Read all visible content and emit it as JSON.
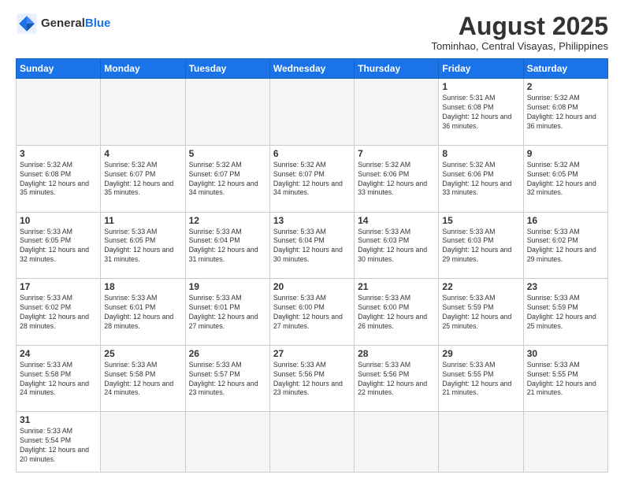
{
  "header": {
    "logo_general": "General",
    "logo_blue": "Blue",
    "month_year": "August 2025",
    "location": "Tominhao, Central Visayas, Philippines"
  },
  "weekdays": [
    "Sunday",
    "Monday",
    "Tuesday",
    "Wednesday",
    "Thursday",
    "Friday",
    "Saturday"
  ],
  "weeks": [
    [
      {
        "day": "",
        "info": ""
      },
      {
        "day": "",
        "info": ""
      },
      {
        "day": "",
        "info": ""
      },
      {
        "day": "",
        "info": ""
      },
      {
        "day": "",
        "info": ""
      },
      {
        "day": "1",
        "info": "Sunrise: 5:31 AM\nSunset: 6:08 PM\nDaylight: 12 hours and 36 minutes."
      },
      {
        "day": "2",
        "info": "Sunrise: 5:32 AM\nSunset: 6:08 PM\nDaylight: 12 hours and 36 minutes."
      }
    ],
    [
      {
        "day": "3",
        "info": "Sunrise: 5:32 AM\nSunset: 6:08 PM\nDaylight: 12 hours and 35 minutes."
      },
      {
        "day": "4",
        "info": "Sunrise: 5:32 AM\nSunset: 6:07 PM\nDaylight: 12 hours and 35 minutes."
      },
      {
        "day": "5",
        "info": "Sunrise: 5:32 AM\nSunset: 6:07 PM\nDaylight: 12 hours and 34 minutes."
      },
      {
        "day": "6",
        "info": "Sunrise: 5:32 AM\nSunset: 6:07 PM\nDaylight: 12 hours and 34 minutes."
      },
      {
        "day": "7",
        "info": "Sunrise: 5:32 AM\nSunset: 6:06 PM\nDaylight: 12 hours and 33 minutes."
      },
      {
        "day": "8",
        "info": "Sunrise: 5:32 AM\nSunset: 6:06 PM\nDaylight: 12 hours and 33 minutes."
      },
      {
        "day": "9",
        "info": "Sunrise: 5:32 AM\nSunset: 6:05 PM\nDaylight: 12 hours and 32 minutes."
      }
    ],
    [
      {
        "day": "10",
        "info": "Sunrise: 5:33 AM\nSunset: 6:05 PM\nDaylight: 12 hours and 32 minutes."
      },
      {
        "day": "11",
        "info": "Sunrise: 5:33 AM\nSunset: 6:05 PM\nDaylight: 12 hours and 31 minutes."
      },
      {
        "day": "12",
        "info": "Sunrise: 5:33 AM\nSunset: 6:04 PM\nDaylight: 12 hours and 31 minutes."
      },
      {
        "day": "13",
        "info": "Sunrise: 5:33 AM\nSunset: 6:04 PM\nDaylight: 12 hours and 30 minutes."
      },
      {
        "day": "14",
        "info": "Sunrise: 5:33 AM\nSunset: 6:03 PM\nDaylight: 12 hours and 30 minutes."
      },
      {
        "day": "15",
        "info": "Sunrise: 5:33 AM\nSunset: 6:03 PM\nDaylight: 12 hours and 29 minutes."
      },
      {
        "day": "16",
        "info": "Sunrise: 5:33 AM\nSunset: 6:02 PM\nDaylight: 12 hours and 29 minutes."
      }
    ],
    [
      {
        "day": "17",
        "info": "Sunrise: 5:33 AM\nSunset: 6:02 PM\nDaylight: 12 hours and 28 minutes."
      },
      {
        "day": "18",
        "info": "Sunrise: 5:33 AM\nSunset: 6:01 PM\nDaylight: 12 hours and 28 minutes."
      },
      {
        "day": "19",
        "info": "Sunrise: 5:33 AM\nSunset: 6:01 PM\nDaylight: 12 hours and 27 minutes."
      },
      {
        "day": "20",
        "info": "Sunrise: 5:33 AM\nSunset: 6:00 PM\nDaylight: 12 hours and 27 minutes."
      },
      {
        "day": "21",
        "info": "Sunrise: 5:33 AM\nSunset: 6:00 PM\nDaylight: 12 hours and 26 minutes."
      },
      {
        "day": "22",
        "info": "Sunrise: 5:33 AM\nSunset: 5:59 PM\nDaylight: 12 hours and 25 minutes."
      },
      {
        "day": "23",
        "info": "Sunrise: 5:33 AM\nSunset: 5:59 PM\nDaylight: 12 hours and 25 minutes."
      }
    ],
    [
      {
        "day": "24",
        "info": "Sunrise: 5:33 AM\nSunset: 5:58 PM\nDaylight: 12 hours and 24 minutes."
      },
      {
        "day": "25",
        "info": "Sunrise: 5:33 AM\nSunset: 5:58 PM\nDaylight: 12 hours and 24 minutes."
      },
      {
        "day": "26",
        "info": "Sunrise: 5:33 AM\nSunset: 5:57 PM\nDaylight: 12 hours and 23 minutes."
      },
      {
        "day": "27",
        "info": "Sunrise: 5:33 AM\nSunset: 5:56 PM\nDaylight: 12 hours and 23 minutes."
      },
      {
        "day": "28",
        "info": "Sunrise: 5:33 AM\nSunset: 5:56 PM\nDaylight: 12 hours and 22 minutes."
      },
      {
        "day": "29",
        "info": "Sunrise: 5:33 AM\nSunset: 5:55 PM\nDaylight: 12 hours and 21 minutes."
      },
      {
        "day": "30",
        "info": "Sunrise: 5:33 AM\nSunset: 5:55 PM\nDaylight: 12 hours and 21 minutes."
      }
    ],
    [
      {
        "day": "31",
        "info": "Sunrise: 5:33 AM\nSunset: 5:54 PM\nDaylight: 12 hours and 20 minutes."
      },
      {
        "day": "",
        "info": ""
      },
      {
        "day": "",
        "info": ""
      },
      {
        "day": "",
        "info": ""
      },
      {
        "day": "",
        "info": ""
      },
      {
        "day": "",
        "info": ""
      },
      {
        "day": "",
        "info": ""
      }
    ]
  ]
}
